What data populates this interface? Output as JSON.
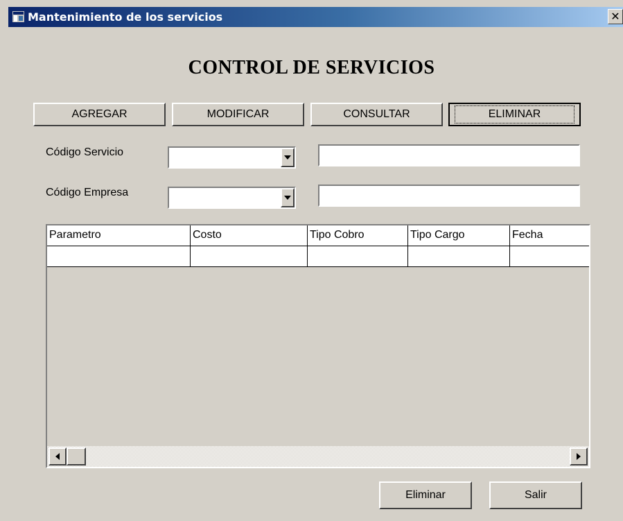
{
  "window": {
    "title": "Mantenimiento de los servicios",
    "close_glyph": "✕"
  },
  "heading": "CONTROL DE SERVICIOS",
  "toolbar": {
    "agregar": "AGREGAR",
    "modificar": "MODIFICAR",
    "consultar": "CONSULTAR",
    "eliminar": "ELIMINAR"
  },
  "form": {
    "codigo_servicio_label": "Código Servicio",
    "codigo_empresa_label": "Código Empresa",
    "codigo_servicio_value": "",
    "codigo_empresa_value": "",
    "servicio_desc_value": "",
    "empresa_desc_value": ""
  },
  "grid": {
    "columns": [
      "Parametro",
      "Costo",
      "Tipo Cobro",
      "Tipo Cargo",
      "Fecha"
    ],
    "rows": [
      [
        "",
        "",
        "",
        "",
        ""
      ]
    ]
  },
  "footer": {
    "eliminar": "Eliminar",
    "salir": "Salir"
  },
  "icons": {
    "app": "window-app-icon",
    "close": "close-icon",
    "dropdown": "chevron-down-icon",
    "scroll_left": "arrow-left-icon",
    "scroll_right": "arrow-right-icon"
  },
  "colors": {
    "titlebar_start": "#0a246a",
    "titlebar_end": "#a6caf0",
    "face": "#d4d0c8"
  }
}
